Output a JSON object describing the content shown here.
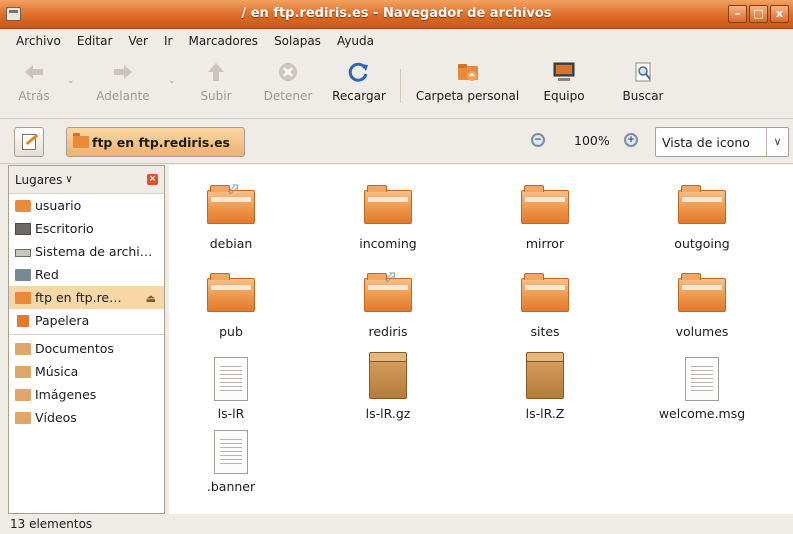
{
  "window": {
    "title": "/ en ftp.rediris.es - Navegador de archivos"
  },
  "menu": [
    "Archivo",
    "Editar",
    "Ver",
    "Ir",
    "Marcadores",
    "Solapas",
    "Ayuda"
  ],
  "toolbar": {
    "back": "Atrás",
    "forward": "Adelante",
    "up": "Subir",
    "stop": "Detener",
    "reload": "Recargar",
    "home": "Carpeta personal",
    "computer": "Equipo",
    "search": "Buscar"
  },
  "location": {
    "path": "ftp en ftp.rediris.es",
    "zoom": "100%",
    "view": "Vista de icono"
  },
  "sidebar": {
    "header": "Lugares",
    "items": [
      {
        "label": "usuario",
        "icon": "home-icon"
      },
      {
        "label": "Escritorio",
        "icon": "desktop-icon"
      },
      {
        "label": "Sistema de archi…",
        "icon": "filesystem-icon"
      },
      {
        "label": "Red",
        "icon": "network-icon"
      },
      {
        "label": "ftp en ftp.re…",
        "icon": "ftp-icon"
      },
      {
        "label": "Papelera",
        "icon": "trash-icon"
      }
    ],
    "bookmarks": [
      {
        "label": "Documentos",
        "icon": "folder-icon"
      },
      {
        "label": "Música",
        "icon": "folder-icon"
      },
      {
        "label": "Imágenes",
        "icon": "folder-icon"
      },
      {
        "label": "Vídeos",
        "icon": "folder-icon"
      }
    ]
  },
  "files": [
    {
      "name": "debian",
      "type": "folder-link"
    },
    {
      "name": "incoming",
      "type": "folder"
    },
    {
      "name": "mirror",
      "type": "folder"
    },
    {
      "name": "outgoing",
      "type": "folder"
    },
    {
      "name": "pub",
      "type": "folder"
    },
    {
      "name": "rediris",
      "type": "folder-link"
    },
    {
      "name": "sites",
      "type": "folder"
    },
    {
      "name": "volumes",
      "type": "folder"
    },
    {
      "name": "ls-lR",
      "type": "text"
    },
    {
      "name": "ls-lR.gz",
      "type": "archive"
    },
    {
      "name": "ls-lR.Z",
      "type": "archive"
    },
    {
      "name": "welcome.msg",
      "type": "text"
    },
    {
      "name": ".banner",
      "type": "text"
    }
  ],
  "status": "13 elementos"
}
